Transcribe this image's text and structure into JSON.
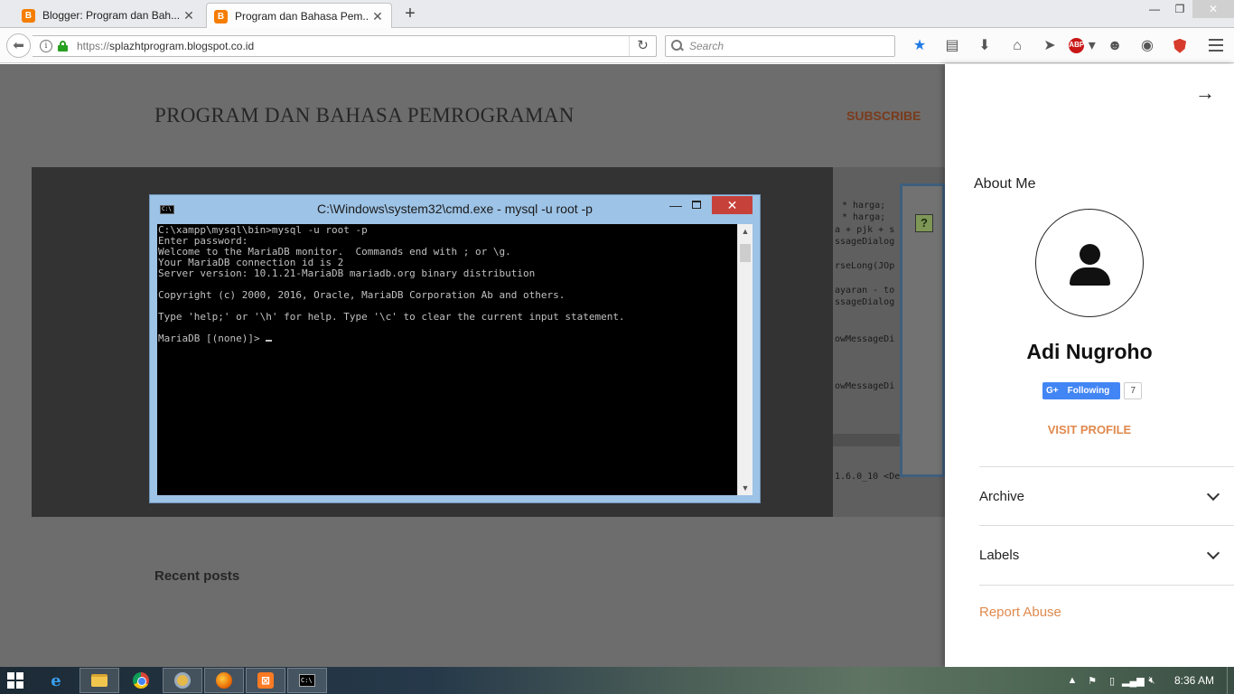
{
  "browser": {
    "tabs": [
      {
        "title": "Blogger: Program dan Bah...",
        "favicon": "blogger-icon",
        "active": false
      },
      {
        "title": "Program dan Bahasa Pem...",
        "favicon": "blogger-icon",
        "active": true
      }
    ],
    "url": {
      "scheme": "https://",
      "host": "splazhtprogram.blogspot.co.id"
    },
    "search_placeholder": "Search",
    "toolbar_icons": [
      "bookmark-star-icon",
      "reading-list-icon",
      "download-icon",
      "home-icon",
      "send-icon",
      "adblock-icon",
      "emoji-icon",
      "eye-icon",
      "shield-icon",
      "menu-icon"
    ],
    "abp_label": "ABP"
  },
  "blog": {
    "title": "PROGRAM DAN BAHASA PEMROGRAMAN",
    "subscribe_label": "SUBSCRIBE",
    "recent_posts_label": "Recent posts"
  },
  "cmd": {
    "title": "C:\\Windows\\system32\\cmd.exe - mysql  -u root -p",
    "lines": [
      "C:\\xampp\\mysql\\bin>mysql -u root -p",
      "Enter password:",
      "Welcome to the MariaDB monitor.  Commands end with ; or \\g.",
      "Your MariaDB connection id is 2",
      "Server version: 10.1.21-MariaDB mariadb.org binary distribution",
      "",
      "Copyright (c) 2000, 2016, Oracle, MariaDB Corporation Ab and others.",
      "",
      "Type 'help;' or '\\h' for help. Type '\\c' to clear the current input statement.",
      "",
      "MariaDB [(none)]> "
    ]
  },
  "background_code": {
    "lines": [
      "* harga;",
      "* harga;",
      "a + pjk + s",
      "ssageDialog",
      "rseLong(JOp",
      "ayaran - to",
      "ssageDialog",
      "owMessageDi",
      "owMessageDi",
      "1.6.0_10 <De"
    ],
    "help_glyph": "?"
  },
  "sidebar": {
    "about_title": "About Me",
    "profile_name": "Adi Nugroho",
    "gplus_label": "Following",
    "gplus_g": "G+",
    "gplus_count": "7",
    "visit_profile_label": "VISIT PROFILE",
    "sections": [
      {
        "label": "Archive"
      },
      {
        "label": "Labels"
      }
    ],
    "report_abuse_label": "Report Abuse"
  },
  "taskbar": {
    "apps": [
      "internet-explorer",
      "file-explorer",
      "chrome",
      "settings",
      "firefox",
      "xampp",
      "cmd"
    ],
    "clock": "8:36 AM"
  }
}
